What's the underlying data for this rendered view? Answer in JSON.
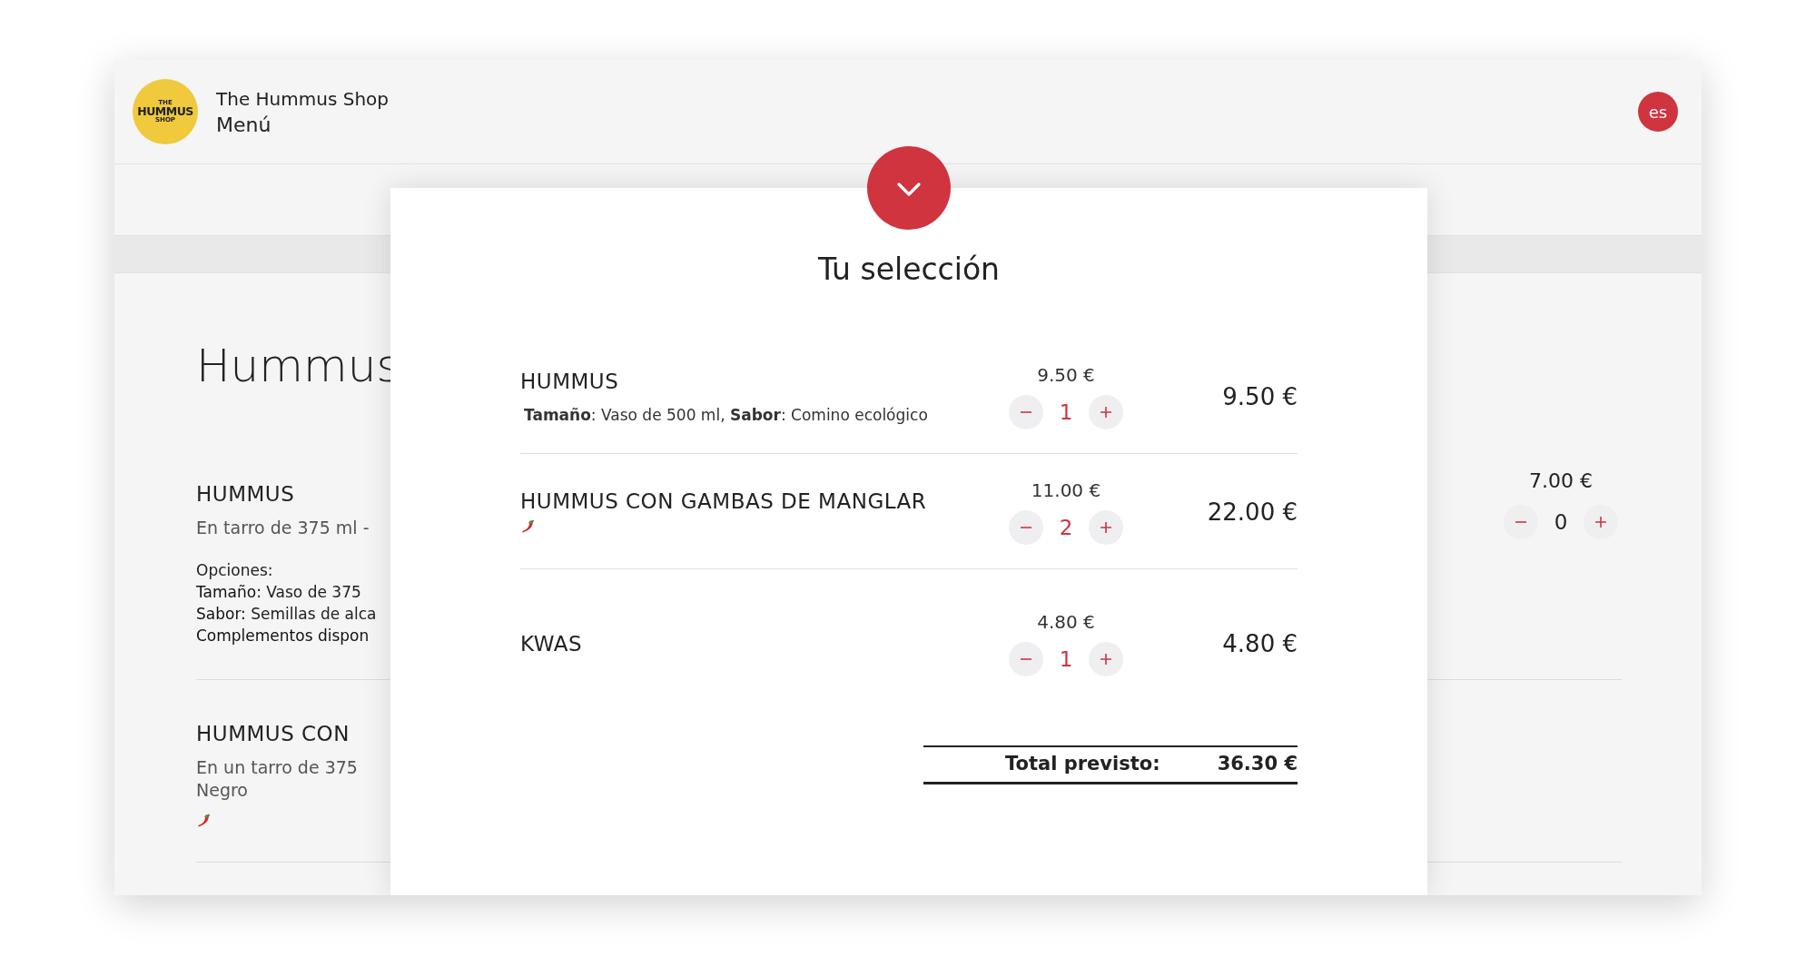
{
  "header": {
    "logo": {
      "lines": [
        "THE",
        "HUMMUS",
        "SHOP"
      ]
    },
    "shop_name": "The Hummus Shop",
    "page_title": "Menú",
    "language_button": "es"
  },
  "menu": {
    "section_title": "Hummus",
    "items": [
      {
        "name": "HUMMUS",
        "description": [
          "En tarro de 375 ml -"
        ],
        "options_label": "Opciones:",
        "options": [
          {
            "label": "Tamaño:",
            "value": "Vaso de 375"
          },
          {
            "label": "Sabor:",
            "value": "Semillas de alca"
          },
          {
            "label": "Complementos dispon"
          }
        ],
        "spicy": false,
        "price": "7.00 €",
        "quantity": "0"
      },
      {
        "name": "HUMMUS CON",
        "description": [
          "En un tarro de 375",
          "Negro"
        ],
        "spicy": true
      }
    ]
  },
  "selection": {
    "title": "Tu selección",
    "lines": [
      {
        "name": "HUMMUS",
        "options": "**Tamaño**: Vaso de 500 ml, **Sabor**: Comino ecológico",
        "spicy": false,
        "unit_price": "9.50 €",
        "quantity": "1",
        "line_total": "9.50 €"
      },
      {
        "name": "HUMMUS CON GAMBAS DE MANGLAR",
        "spicy": true,
        "unit_price": "11.00 €",
        "quantity": "2",
        "line_total": "22.00 €"
      },
      {
        "name": "KWAS",
        "spicy": false,
        "unit_price": "4.80 €",
        "quantity": "1",
        "line_total": "4.80 €"
      }
    ],
    "total_label": "Total previsto:",
    "total_value": "36.30 €"
  }
}
